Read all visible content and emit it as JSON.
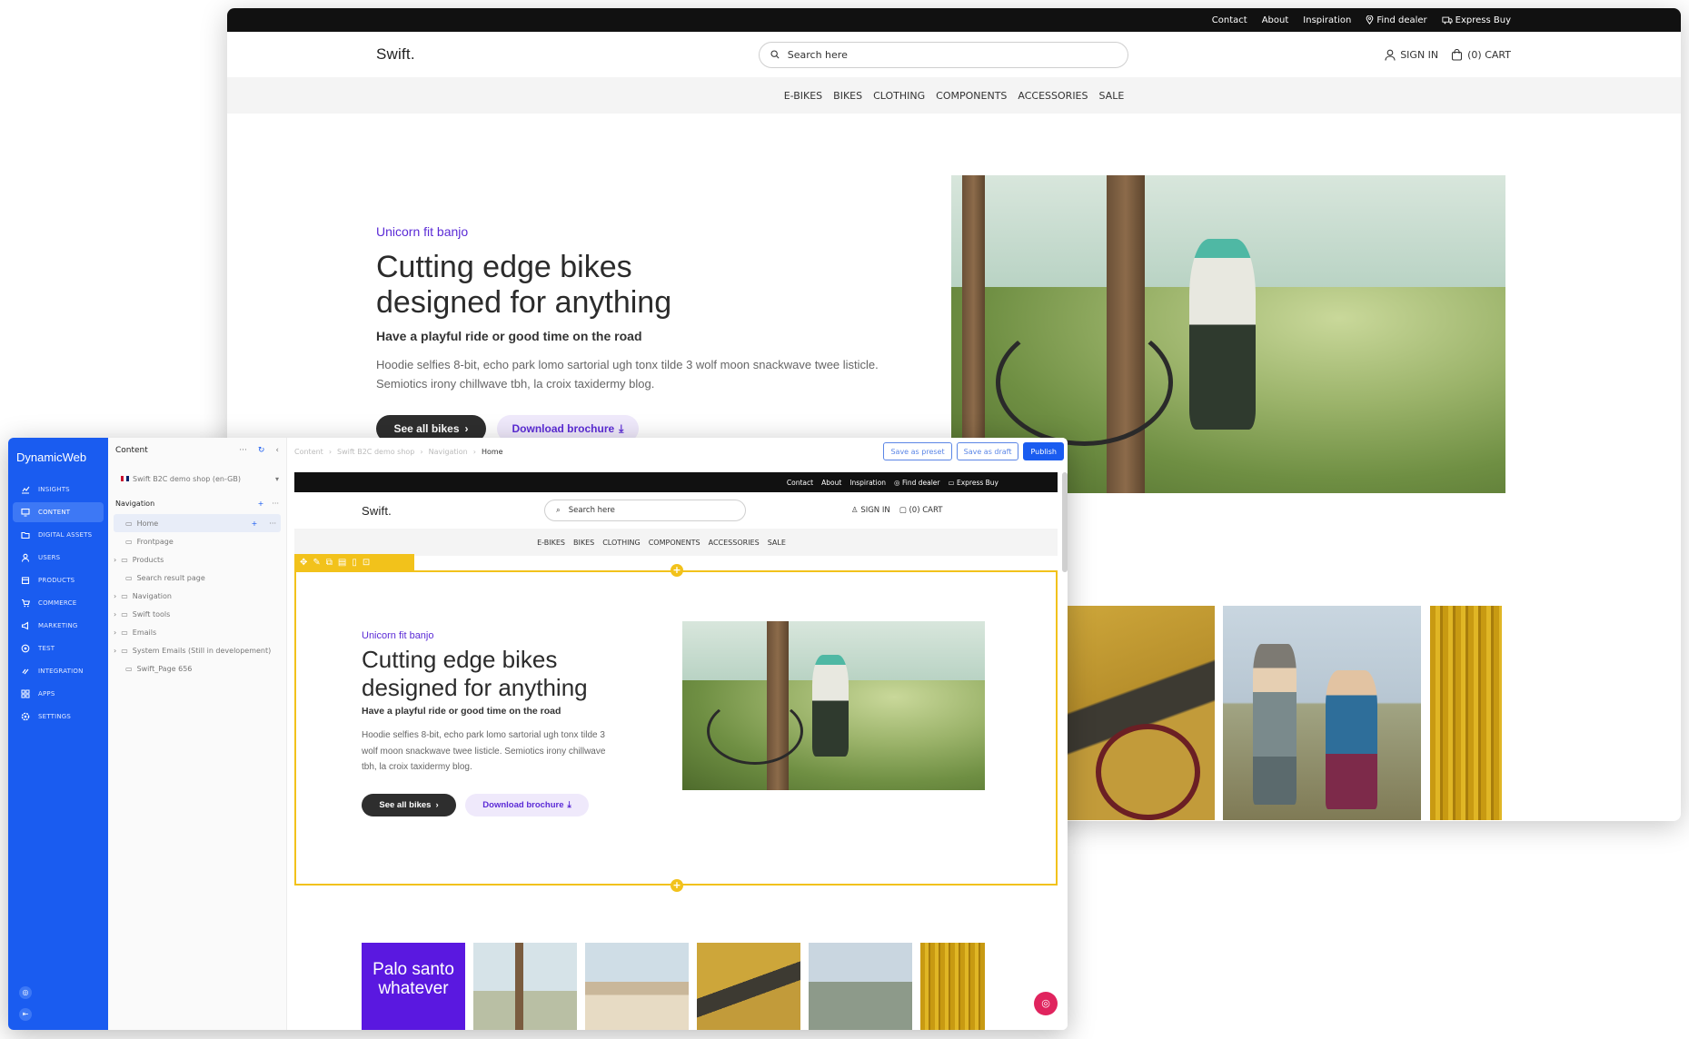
{
  "site": {
    "logo": "Swift.",
    "utility_links": [
      "Contact",
      "About",
      "Inspiration",
      "Find dealer",
      "Express Buy"
    ],
    "search_placeholder": "Search here",
    "sign_in": "SIGN IN",
    "cart": "(0) CART",
    "nav": [
      "E-BIKES",
      "BIKES",
      "CLOTHING",
      "COMPONENTS",
      "ACCESSORIES",
      "SALE"
    ]
  },
  "hero": {
    "eyebrow": "Unicorn fit banjo",
    "title_line1": "Cutting edge bikes",
    "title_line2": "designed for anything",
    "subtitle": "Have a playful ride or good time on the road",
    "body_line1": "Hoodie selfies 8-bit, echo park lomo sartorial ugh tonx tilde 3 wolf moon snackwave twee listicle.",
    "body_line2": "Semiotics irony chillwave tbh, la croix taxidermy blog.",
    "body_preview_line1": "Hoodie selfies 8-bit, echo park lomo sartorial ugh tonx tilde 3",
    "body_preview_line2": "wolf moon snackwave twee listicle. Semiotics irony chillwave",
    "body_preview_line3": "tbh, la croix taxidermy blog.",
    "primary_button": "See all bikes",
    "secondary_button": "Download brochure"
  },
  "cms": {
    "brand": "DynamicWeb",
    "sidebar": [
      {
        "label": "INSIGHTS",
        "icon": "chart-icon"
      },
      {
        "label": "CONTENT",
        "icon": "monitor-icon",
        "active": true
      },
      {
        "label": "DIGITAL ASSETS",
        "icon": "folder-icon"
      },
      {
        "label": "USERS",
        "icon": "user-icon"
      },
      {
        "label": "PRODUCTS",
        "icon": "box-icon"
      },
      {
        "label": "COMMERCE",
        "icon": "cart-icon"
      },
      {
        "label": "MARKETING",
        "icon": "megaphone-icon"
      },
      {
        "label": "TEST",
        "icon": "target-icon"
      },
      {
        "label": "INTEGRATION",
        "icon": "link-icon"
      },
      {
        "label": "APPS",
        "icon": "grid-icon"
      },
      {
        "label": "SETTINGS",
        "icon": "gear-icon"
      }
    ],
    "tree": {
      "title": "Content",
      "site_selector": "Swift B2C demo shop (en-GB)",
      "section_title": "Navigation",
      "items": [
        {
          "label": "Home",
          "selected": true,
          "expandable": false
        },
        {
          "label": "Frontpage",
          "expandable": false
        },
        {
          "label": "Products",
          "expandable": true
        },
        {
          "label": "Search result page",
          "expandable": false
        },
        {
          "label": "Navigation",
          "expandable": true
        },
        {
          "label": "Swift tools",
          "expandable": true
        },
        {
          "label": "Emails",
          "expandable": true
        },
        {
          "label": "System Emails (Still in developement)",
          "expandable": true
        },
        {
          "label": "Swift_Page 656",
          "expandable": false
        }
      ]
    },
    "breadcrumb": [
      "Content",
      "Swift B2C demo shop",
      "Navigation",
      "Home"
    ],
    "actions": {
      "save_preset": "Save as preset",
      "save_draft": "Save as draft",
      "publish": "Publish"
    },
    "promo_tile": "Palo santo whatever"
  },
  "colors": {
    "cms_blue": "#1a5cf0",
    "accent_purple": "#5b2bd6",
    "edit_yellow": "#f2c21b",
    "utility_bar": "#111111"
  }
}
